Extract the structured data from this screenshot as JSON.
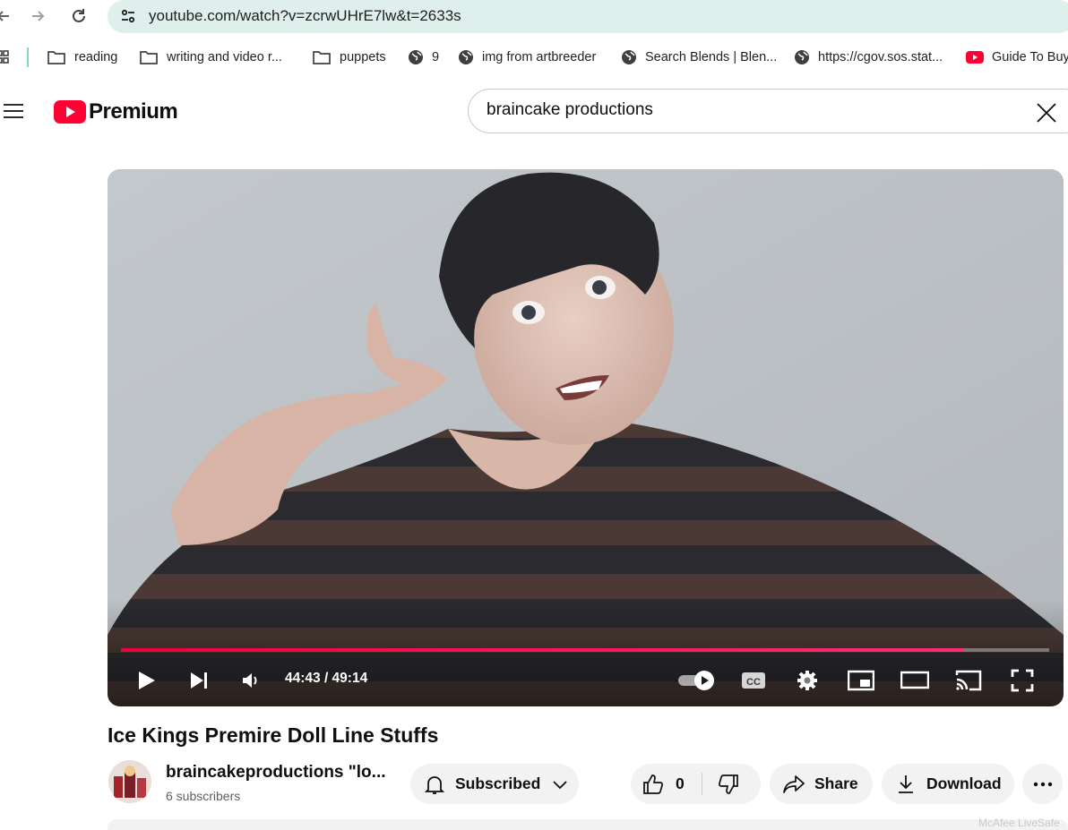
{
  "browser": {
    "url": "youtube.com/watch?v=zcrwUHrE7lw&t=2633s",
    "bookmarks": [
      {
        "label": "reading",
        "icon": "folder-icon"
      },
      {
        "label": "writing and video r...",
        "icon": "folder-icon"
      },
      {
        "label": "puppets",
        "icon": "folder-icon"
      },
      {
        "label": "9",
        "icon": "globe-icon"
      },
      {
        "label": "img from artbreeder",
        "icon": "globe-icon"
      },
      {
        "label": "Search Blends | Blen...",
        "icon": "globe-icon"
      },
      {
        "label": "https://cgov.sos.stat...",
        "icon": "globe-icon"
      },
      {
        "label": "Guide To Buy",
        "icon": "youtube-icon"
      }
    ]
  },
  "youtube": {
    "logo_text": "Premium",
    "search_value": "braincake productions",
    "brand_color": "#ff0033"
  },
  "player": {
    "current_time": "44:43",
    "duration": "49:14",
    "time_display": "44:43 / 49:14",
    "progress_fraction": 0.908,
    "autoplay_on": true
  },
  "video": {
    "title": "Ice Kings Premire Doll Line Stuffs",
    "channel_name": "braincakeproductions \"lo...",
    "subscribers": "6 subscribers",
    "subscribe_label": "Subscribed",
    "like_count": "0",
    "share_label": "Share",
    "download_label": "Download"
  },
  "extension_text": "McAfee LiveSafe"
}
